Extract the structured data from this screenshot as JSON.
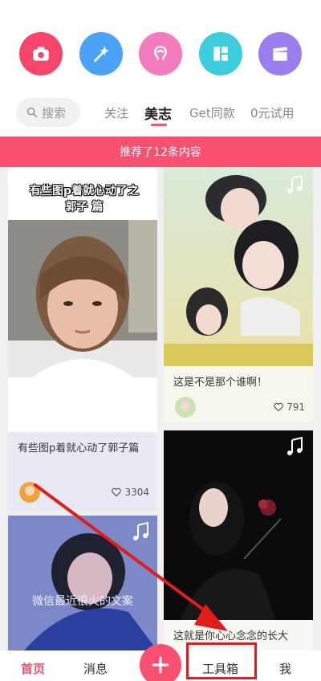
{
  "circles": [
    {
      "name": "camera",
      "color": "#f74669",
      "icon": "camera-icon"
    },
    {
      "name": "magic",
      "color": "#4aa3f7",
      "icon": "magic-wand-icon"
    },
    {
      "name": "beauty",
      "color": "#f57bbf",
      "icon": "beauty-icon"
    },
    {
      "name": "collage",
      "color": "#3ecddd",
      "icon": "collage-icon"
    },
    {
      "name": "video",
      "color": "#9a7ef0",
      "icon": "video-clapper-icon"
    }
  ],
  "tabs": {
    "search": "搜索",
    "follow": "关注",
    "meizhi": "美志",
    "get_same": "Get同款",
    "free_trial": "0元试用"
  },
  "banner": "推荐了12条内容",
  "cards": [
    {
      "overlay_text": "有些图p着就心动了之郭子 篇",
      "title": "有些图p着就心动了郭子篇",
      "likes": "3304"
    },
    {
      "title": "这是不是那个谁啊！",
      "likes": "791"
    },
    {
      "overlay_text": "微信最近很火的文案",
      "title": ""
    },
    {
      "title": "这就是你心心念念的长大"
    }
  ],
  "nav": {
    "home": "首页",
    "messages": "消息",
    "toolbox": "工具箱",
    "me": "我"
  },
  "colors": {
    "accent": "#f9506f",
    "highlight": "#e31b1b"
  }
}
